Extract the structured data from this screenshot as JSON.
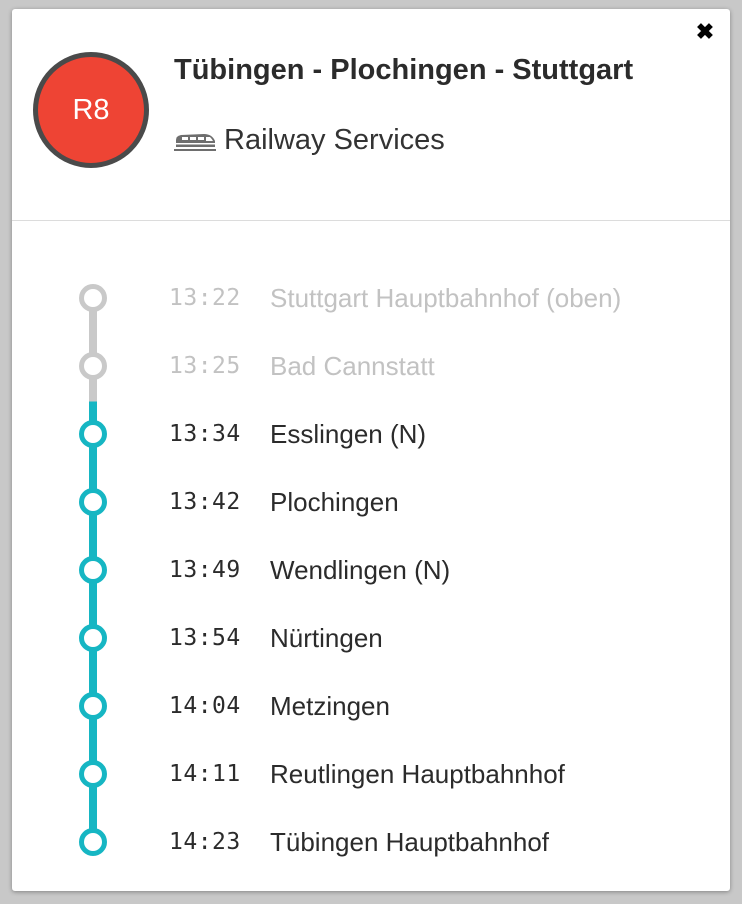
{
  "popup": {
    "close_icon": "✖",
    "route_short": "R8",
    "route_title": "Tübingen - Plochingen - Stuttgart",
    "operator_icon": "train-icon",
    "operator": "Railway Services"
  },
  "colors": {
    "badge": "#ee4434",
    "badge_border": "#4a4a4a",
    "line_active": "#16b6c3",
    "line_past": "#c9c9c9",
    "text_past": "#c2c2c2",
    "text_active": "#2b2b2b"
  },
  "stops": [
    {
      "time": "13:22",
      "name": "Stuttgart Hauptbahnhof (oben)",
      "status": "past"
    },
    {
      "time": "13:25",
      "name": "Bad Cannstatt",
      "status": "past"
    },
    {
      "time": "13:34",
      "name": "Esslingen (N)",
      "status": "upcoming"
    },
    {
      "time": "13:42",
      "name": "Plochingen",
      "status": "upcoming"
    },
    {
      "time": "13:49",
      "name": "Wendlingen (N)",
      "status": "upcoming"
    },
    {
      "time": "13:54",
      "name": "Nürtingen",
      "status": "upcoming"
    },
    {
      "time": "14:04",
      "name": "Metzingen",
      "status": "upcoming"
    },
    {
      "time": "14:11",
      "name": "Reutlingen Hauptbahnhof",
      "status": "upcoming"
    },
    {
      "time": "14:23",
      "name": "Tübingen Hauptbahnhof",
      "status": "upcoming"
    }
  ]
}
